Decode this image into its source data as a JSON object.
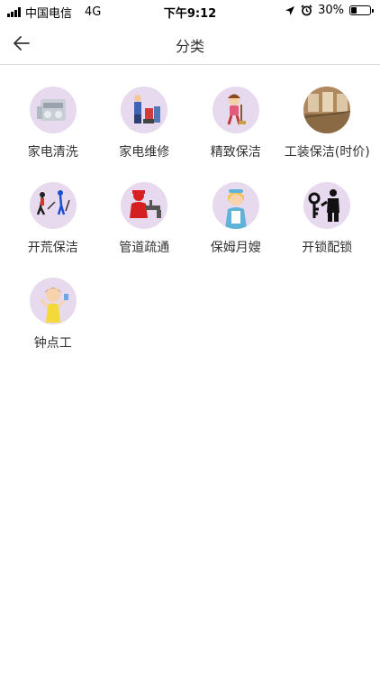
{
  "status_bar": {
    "carrier": "中国电信",
    "network": "4G",
    "time": "下午9:12",
    "battery": "30%",
    "battery_level": 0.3
  },
  "nav": {
    "title": "分类",
    "back_icon": "arrow-left-icon"
  },
  "categories": [
    {
      "label": "家电清洗",
      "icon": "appliance-cleaning-icon"
    },
    {
      "label": "家电维修",
      "icon": "appliance-repair-icon"
    },
    {
      "label": "精致保洁",
      "icon": "fine-cleaning-icon"
    },
    {
      "label": "工装保洁(时价)",
      "icon": "office-cleaning-icon"
    },
    {
      "label": "开荒保洁",
      "icon": "deep-cleaning-icon"
    },
    {
      "label": "管道疏通",
      "icon": "pipe-dredging-icon"
    },
    {
      "label": "保姆月嫂",
      "icon": "nanny-icon"
    },
    {
      "label": "开锁配锁",
      "icon": "locksmith-icon"
    },
    {
      "label": "钟点工",
      "icon": "hourly-worker-icon"
    }
  ]
}
